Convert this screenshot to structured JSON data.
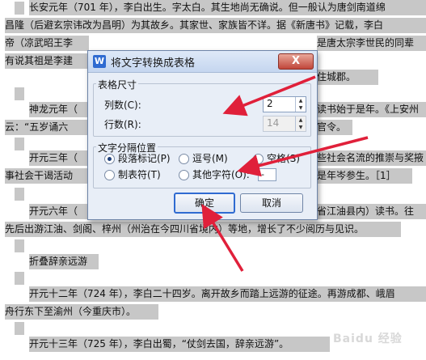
{
  "document": {
    "lines": [
      "长安元年（701 年），李白出生。字太白。其生地尚无确说。但一般认为唐剑南道绵",
      "昌隆（后避玄宗讳改为昌明）为其故乡。其家世、家族皆不详。据《新唐书》记载，李白",
      "帝（凉武昭王李",
      "是唐太宗李世民的同辈",
      "有说其祖是李建",
      "住城郡。",
      "神龙元年（",
      "读书始于是年。《上安州",
      "云：“五岁诵六",
      "官令。",
      "开元三年（",
      "些社会名流的推崇与奖掖",
      "事社会干谒活动",
      "是年岑参生。［1］",
      "开元六年（",
      "省江油县内）读书。往",
      "先后出游江油、剑阁、梓州（州治在今四川省境内）等地，增长了不少阅历与见识。",
      "折叠辞亲远游",
      "开元十二年（724 年），李白二十四岁。离开故乡而踏上远游的征途。再游成都、峨眉",
      "舟行东下至渝州（今重庆市）。",
      "开元十三年（725 年），李白出蜀，“仗剑去国，辞亲远游”。"
    ]
  },
  "dialog": {
    "title": "将文字转换成表格",
    "app_icon": "W",
    "close_label": "X",
    "table_size": {
      "legend": "表格尺寸",
      "columns_label": "列数(C):",
      "columns_value": "2",
      "rows_label": "行数(R):",
      "rows_value": "14"
    },
    "separator": {
      "legend": "文字分隔位置",
      "options": [
        {
          "label": "段落标记(P)",
          "checked": true
        },
        {
          "label": "逗号(M)",
          "checked": false
        },
        {
          "label": "空格(S)",
          "checked": false
        },
        {
          "label": "制表符(T)",
          "checked": false
        },
        {
          "label": "其他字符(O):",
          "checked": false
        }
      ],
      "other_value": "-"
    },
    "ok_label": "确定",
    "cancel_label": "取消"
  },
  "watermark": "Baidu 经验",
  "colors": {
    "highlight": "#c7c7c7",
    "arrow": "#e0203a",
    "dialog_bg": "#e8eef7"
  }
}
